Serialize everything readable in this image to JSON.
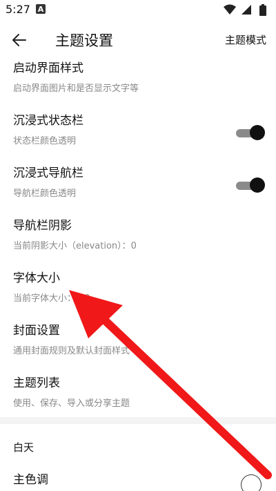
{
  "status_bar": {
    "time": "5:27",
    "notification_badge": "A",
    "icons": [
      "wifi-icon",
      "signal-icon",
      "battery-icon"
    ]
  },
  "app_bar": {
    "title": "主题设置",
    "action": "主题模式"
  },
  "settings": [
    {
      "title": "启动界面样式",
      "subtitle": "启动界面图片和是否显示文字等"
    },
    {
      "title": "沉浸式状态栏",
      "subtitle": "状态栏颜色透明",
      "toggle": true
    },
    {
      "title": "沉浸式导航栏",
      "subtitle": "导航栏颜色透明",
      "toggle": true
    },
    {
      "title": "导航栏阴影",
      "subtitle": "当前阴影大小（elevation）：0"
    },
    {
      "title": "字体大小",
      "subtitle": "当前字体大小：1.0"
    },
    {
      "title": "封面设置",
      "subtitle": "通用封面规则及默认封面样式"
    },
    {
      "title": "主题列表",
      "subtitle": "使用、保存、导入或分享主题"
    }
  ],
  "section": {
    "label": "白天",
    "primary_color_label": "主色调"
  },
  "colors": {
    "annotation_arrow": "#f01818",
    "toggle_thumb": "#111111",
    "toggle_track": "#8a8a8a"
  }
}
